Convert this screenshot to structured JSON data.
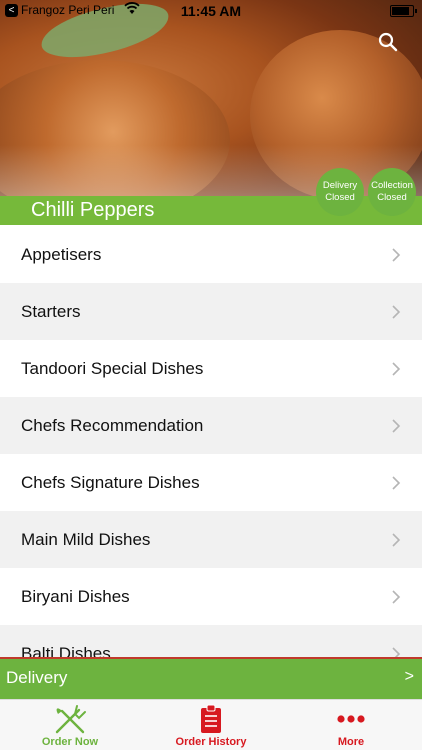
{
  "status_bar": {
    "back_glyph": "<",
    "carrier": "Frangoz Peri Peri",
    "time": "11:45 AM"
  },
  "restaurant": {
    "name": "Chilli Peppers"
  },
  "badges": {
    "delivery": {
      "line1": "Delivery",
      "line2": "Closed"
    },
    "collection": {
      "line1": "Collection",
      "line2": "Closed"
    }
  },
  "menu": {
    "categories": [
      "Appetisers",
      "Starters",
      "Tandoori Special Dishes",
      "Chefs Recommendation",
      "Chefs Signature Dishes",
      "Main Mild Dishes",
      "Biryani Dishes",
      "Balti Dishes"
    ]
  },
  "delivery_bar": {
    "label": "Delivery",
    "arrow": ">"
  },
  "tabs": [
    {
      "label": "Order Now",
      "icon": "fork-knife-icon"
    },
    {
      "label": "Order History",
      "icon": "clipboard-icon"
    },
    {
      "label": "More",
      "icon": "more-dots-icon"
    }
  ],
  "colors": {
    "brand_green": "#6db33f",
    "accent_red": "#d71920"
  }
}
